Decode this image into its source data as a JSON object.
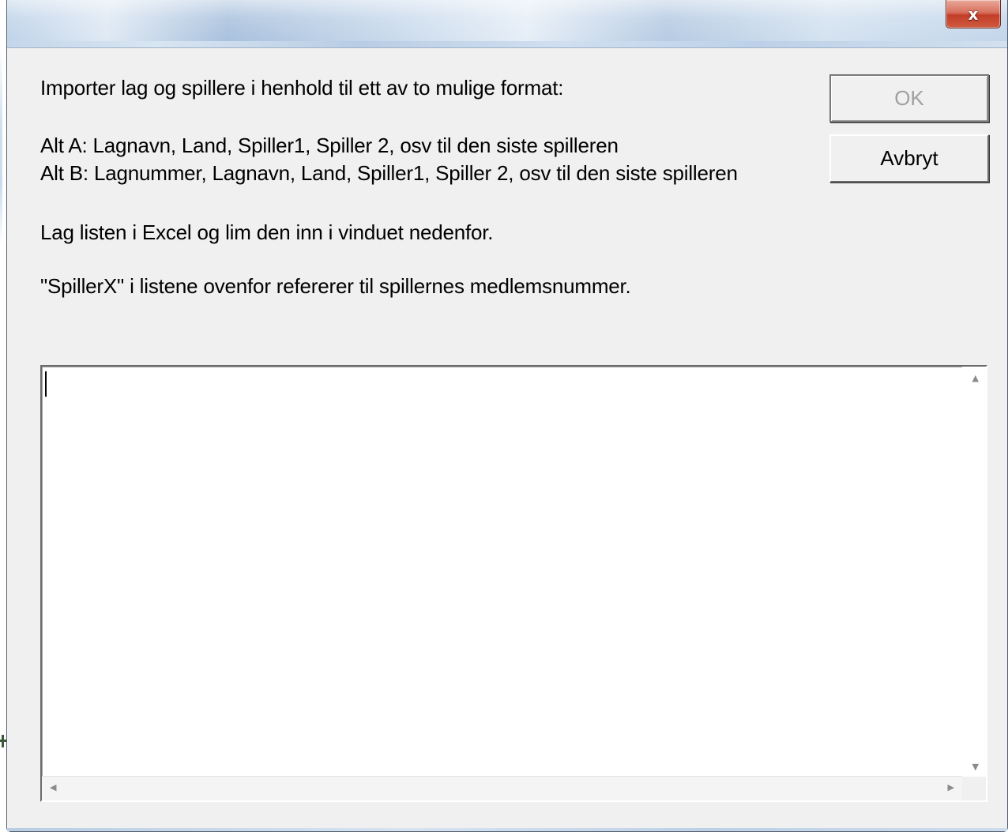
{
  "window": {
    "title": "",
    "close_glyph": "x"
  },
  "instructions": {
    "line1": "Importer lag og spillere i henhold til ett av to mulige format:",
    "alt_a": "Alt A: Lagnavn, Land, Spiller1, Spiller 2, osv til den siste spilleren",
    "alt_b": "Alt B: Lagnummer, Lagnavn, Land, Spiller1, Spiller 2, osv til den siste spilleren",
    "paste_hint": "Lag listen i Excel og lim den inn i vinduet nedenfor.",
    "note": "\"SpillerX\" i listene ovenfor refererer til spillernes medlemsnummer."
  },
  "buttons": {
    "ok_label": "OK",
    "ok_enabled": false,
    "cancel_label": "Avbryt"
  },
  "import_textarea": {
    "value": ""
  },
  "icons": {
    "close": "close-icon",
    "scroll_up": "scroll-up-arrow-icon",
    "scroll_down": "scroll-down-arrow-icon",
    "scroll_left": "scroll-left-arrow-icon",
    "scroll_right": "scroll-right-arrow-icon"
  },
  "colors": {
    "dialog_background": "#f0f0f0",
    "close_button": "#c23e28",
    "disabled_text": "#a0a0a0"
  }
}
